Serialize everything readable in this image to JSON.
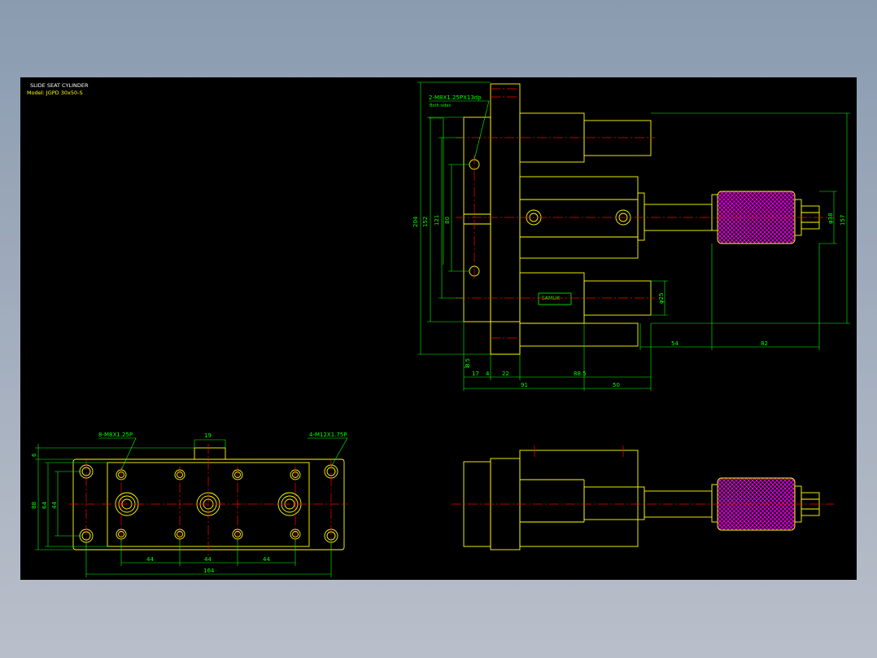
{
  "title_block": {
    "title": "SLIDE SEAT CYLINDER",
    "model": "Model: JGPD 30x50-S"
  },
  "colors": {
    "background": "#000000",
    "outline": "#ffff00",
    "dimension": "#00ff00",
    "centerline": "#ff0000",
    "hatch": "#ff00ff",
    "desktop": "#9aa7b8"
  },
  "front_view": {
    "callout_left": "8-M8X1.25P",
    "callout_right": "4-M12X1.75P",
    "dims": {
      "top": "19",
      "left_small": "6",
      "height_outer": "88",
      "height_mid": "64",
      "height_inner": "44",
      "pitch_1": "44",
      "pitch_2": "44",
      "pitch_3": "44",
      "overall": "164"
    }
  },
  "side_view": {
    "callout": "2-M8X1.25PX13dp",
    "callout_sub": "Both sides",
    "dims": {
      "h204": "204",
      "h152": "152",
      "h121": "121",
      "h80": "80",
      "d38": "φ38",
      "h157": "157",
      "d25": "φ25",
      "w54": "54",
      "w82": "82",
      "w8_5": "8.5",
      "w17": "17",
      "w22": "22",
      "w88_5": "88.5",
      "w91": "91",
      "w50": "50",
      "w4": "4"
    },
    "nameplate": "SAMLIK"
  },
  "bottom_view": {}
}
